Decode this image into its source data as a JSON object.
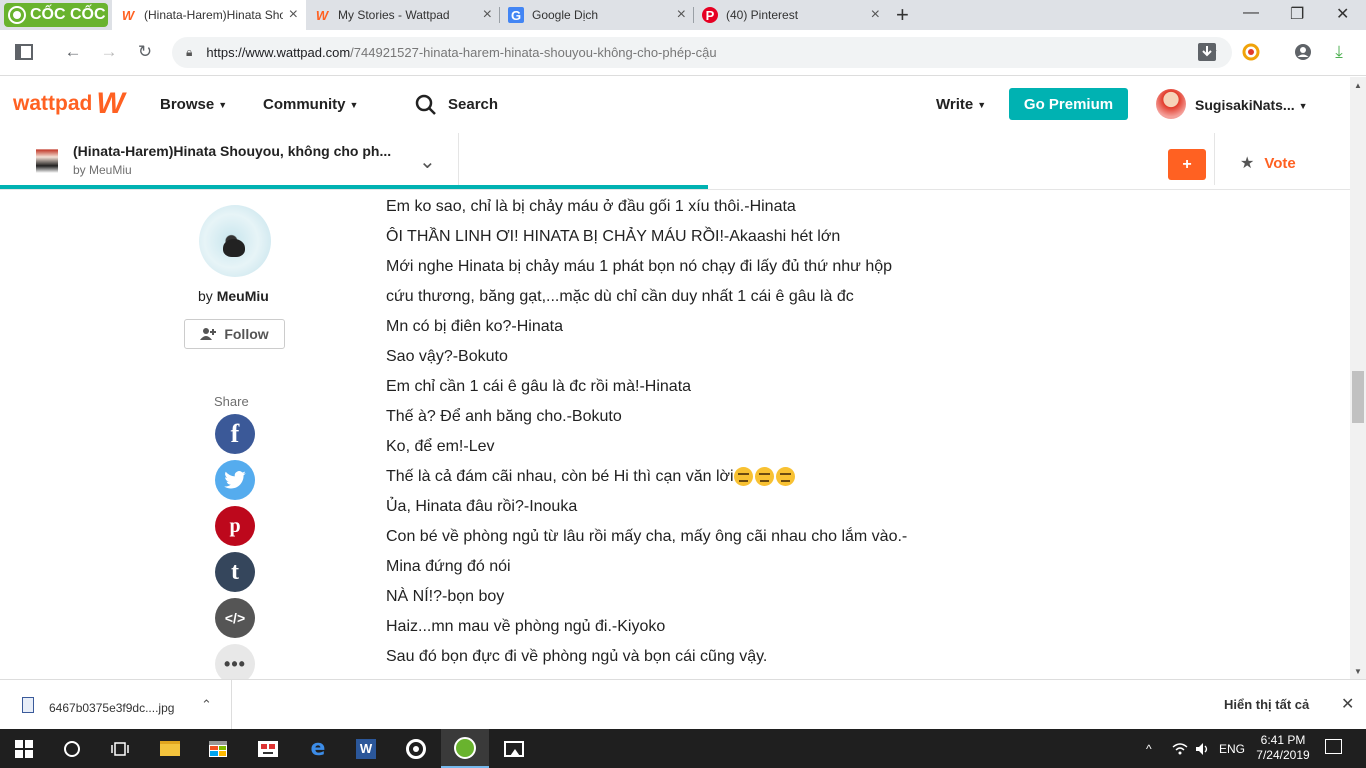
{
  "browser": {
    "brand": "CỐC CỐC",
    "tabs": [
      {
        "title": "(Hinata-Harem)Hinata Sho",
        "favicon": "wattpad-icon",
        "active": true
      },
      {
        "title": "My Stories - Wattpad",
        "favicon": "wattpad-icon",
        "active": false
      },
      {
        "title": "Google Dịch",
        "favicon": "google-translate-icon",
        "active": false
      },
      {
        "title": "(40) Pinterest",
        "favicon": "pinterest-icon",
        "active": false
      }
    ],
    "url_host": "https://www.wattpad.com",
    "url_path": "/744921527-hinata-harem-hinata-shouyou-không-cho-phép-cậu"
  },
  "header": {
    "logo_text": "wattpad",
    "browse": "Browse",
    "community": "Community",
    "search": "Search",
    "write": "Write",
    "premium": "Go Premium",
    "username": "SugisakiNats..."
  },
  "story": {
    "title": "(Hinata-Harem)Hinata Shouyou, không cho ph...",
    "by": "by MeuMiu",
    "add": "+",
    "vote": "Vote",
    "read_progress": 0.518
  },
  "author": {
    "by_prefix": "by",
    "name": "MeuMiu",
    "follow": "Follow"
  },
  "share": {
    "label": "Share",
    "facebook": "f",
    "pinterest": "p",
    "tumblr": "t",
    "embed": "</>",
    "more": "•••"
  },
  "lines": [
    "Em ko sao, chỉ là bị chảy máu ở đầu gối 1 xíu thôi.-Hinata",
    "ÔI THẦN LINH ƠI! HINATA BỊ CHẢY MÁU RỒI!-Akaashi hét lớn",
    "Mới nghe Hinata bị chảy máu 1 phát bọn nó chạy đi lấy đủ thứ như hộp",
    "cứu thương, băng gạt,...mặc dù chỉ cần duy nhất 1 cái ê gâu là đc",
    "Mn có bị điên ko?-Hinata",
    "Sao vậy?-Bokuto",
    "Em chỉ cần 1 cái ê gâu là đc rồi mà!-Hinata",
    "Thế à? Để anh băng cho.-Bokuto",
    "Ko, để em!-Lev",
    "Thế là cả đám cãi nhau, còn bé Hi thì cạn văn lời",
    "Ủa, Hinata đâu rồi?-Inouka",
    "Con bé về phòng ngủ từ lâu rồi mấy cha, mấy ông cãi nhau cho lắm vào.-",
    "Mina đứng đó nói",
    "NÀ NÍ!?-bọn boy",
    "Haiz...mn mau về phòng ngủ đi.-Kiyoko",
    "Sau đó bọn đực đi về phòng ngủ và bọn cái cũng vậy."
  ],
  "download": {
    "filename": "6467b0375e3f9dc....jpg",
    "show_all": "Hiển thị tất cả"
  },
  "taskbar": {
    "language": "ENG",
    "time": "6:41 PM",
    "date": "7/24/2019"
  },
  "colors": {
    "wattpad_orange": "#ff6122",
    "premium_teal": "#00b2b2"
  }
}
